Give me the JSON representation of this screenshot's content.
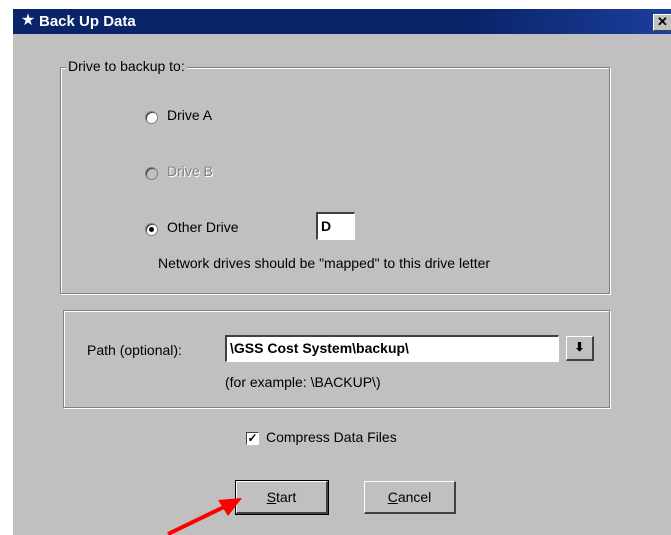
{
  "window": {
    "title": "Back Up Data",
    "close_glyph": "✕"
  },
  "drive_group": {
    "legend": "Drive to backup to:",
    "options": [
      {
        "label": "Drive A",
        "selected": false,
        "enabled": true
      },
      {
        "label": "Drive B",
        "selected": false,
        "enabled": false
      },
      {
        "label": "Other Drive",
        "selected": true,
        "enabled": true
      }
    ],
    "other_drive_value": "D",
    "note": "Network drives should be \"mapped\" to this drive letter"
  },
  "path_group": {
    "label": "Path (optional):",
    "value": "\\GSS Cost System\\backup\\",
    "example": "(for example: \\BACKUP\\)",
    "dropdown_icon": "down-arrow-icon"
  },
  "compress": {
    "label": "Compress Data Files",
    "checked": true
  },
  "buttons": {
    "start_mnemonic": "S",
    "start_rest": "tart",
    "cancel_mnemonic": "C",
    "cancel_rest": "ancel"
  },
  "colors": {
    "titlebar": "#0a246a",
    "face": "#c0c0c0",
    "annotation_arrow": "#ff0000"
  }
}
